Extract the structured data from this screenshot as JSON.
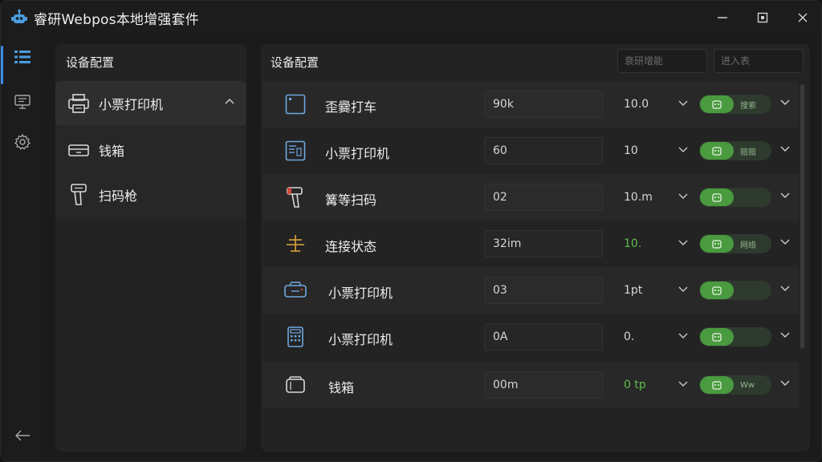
{
  "window": {
    "title": "睿研Webpos本地增强套件",
    "logo_icon": "bot-logo-icon",
    "controls": [
      "minimize-icon",
      "maximize-icon",
      "close-icon"
    ]
  },
  "rail": {
    "items": [
      {
        "icon": "device-list-icon",
        "active": true
      },
      {
        "icon": "monitor-icon",
        "active": false
      },
      {
        "icon": "gear-icon",
        "active": false
      }
    ],
    "bottom_icon": "back-arrow-icon"
  },
  "categories": {
    "heading": "设备配置",
    "items": [
      {
        "label": "小票打印机",
        "icon": "printer-icon",
        "expanded": true
      },
      {
        "label": "钱箱",
        "icon": "cash-drawer-icon"
      },
      {
        "label": "扫码枪",
        "icon": "barcode-scanner-icon"
      }
    ]
  },
  "main": {
    "heading": "设备配置",
    "search1_placeholder": "衰研增能",
    "search2_placeholder": "进入表",
    "rows": [
      {
        "name": "歪爨打车",
        "icon": "square-frame-icon",
        "value": "90k",
        "select": "10.0",
        "select_green": false,
        "toggle_label": "搜索"
      },
      {
        "name": "小票打印机",
        "icon": "receipt-printer-icon",
        "value": "60",
        "select": "10",
        "select_green": false,
        "toggle_label": "赔赔"
      },
      {
        "name": "篝等扫码",
        "icon": "scanner-gun-icon",
        "value": "02",
        "select": "10.m",
        "select_green": false,
        "toggle_label": ""
      },
      {
        "name": "连接状态",
        "icon": "connection-icon",
        "value": "32im",
        "select": "10.",
        "select_green": true,
        "toggle_label": "网络"
      },
      {
        "name": "小票打印机",
        "icon": "printer-tray-icon",
        "value": "03",
        "select": "1pt",
        "select_green": false,
        "toggle_label": ""
      },
      {
        "name": "小票打印机",
        "icon": "calculator-icon",
        "value": "0A",
        "select": "0.",
        "select_green": false,
        "toggle_label": ""
      },
      {
        "name": "钱箱",
        "icon": "drawer-box-icon",
        "value": "00m",
        "select": "0 tp",
        "select_green": true,
        "toggle_label": "Ww"
      }
    ]
  },
  "colors": {
    "accent": "#3b8be8",
    "toggle_on": "#4a9a3f",
    "green_text": "#5bbf4a",
    "icon_amber": "#d9a43a",
    "icon_blue": "#6fa8e0",
    "icon_red": "#d04a3a"
  }
}
